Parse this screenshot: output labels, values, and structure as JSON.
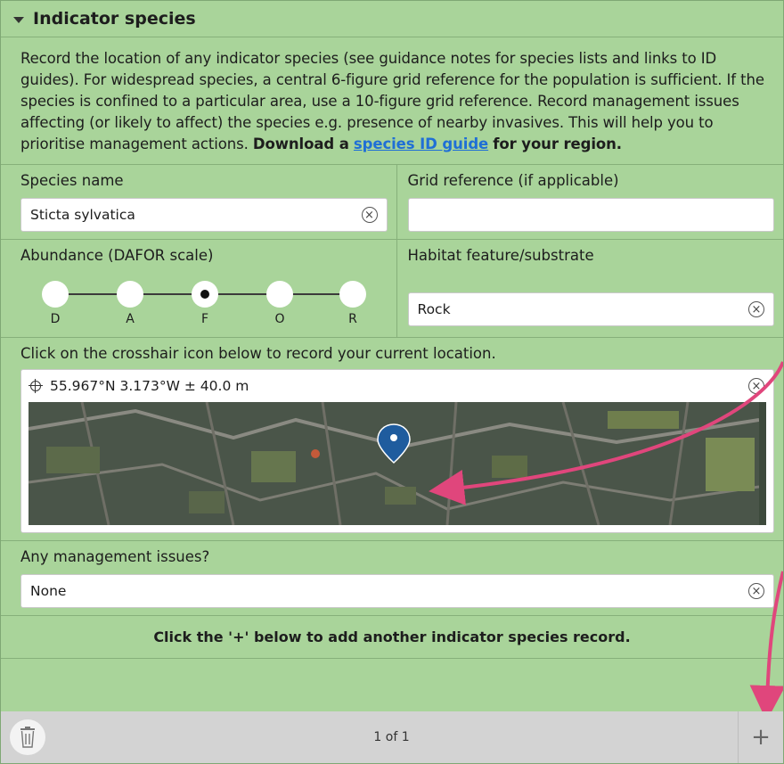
{
  "section": {
    "title": "Indicator species"
  },
  "description": {
    "text": "Record the location of any indicator species (see guidance notes for species lists and links to ID guides). For widespread species, a central 6-figure grid reference for the population is sufficient. If the species is confined to a particular area, use a 10-figure grid reference. Record management issues affecting (or likely to affect) the species e.g. presence of nearby invasives. This will help you to prioritise management actions.",
    "bold_prefix": "Download a",
    "link_text": "species ID guide",
    "bold_suffix": "for your region."
  },
  "species": {
    "label": "Species name",
    "value": "Sticta sylvatica"
  },
  "grid": {
    "label": "Grid reference (if applicable)",
    "value": ""
  },
  "abundance": {
    "label": "Abundance (DAFOR scale)",
    "options": [
      "D",
      "A",
      "F",
      "O",
      "R"
    ],
    "selected": "F"
  },
  "habitat": {
    "label": "Habitat feature/substrate",
    "value": "Rock"
  },
  "location": {
    "label": "Click on the crosshair icon below to record your current location.",
    "coords": "55.967°N 3.173°W ± 40.0 m"
  },
  "management": {
    "label": "Any management issues?",
    "value": "None"
  },
  "note": "Click the '+' below to add another indicator species record.",
  "footer": {
    "pager": "1 of 1"
  },
  "icons": {
    "clear": "clear-icon",
    "crosshair": "crosshair-icon",
    "trash": "trash-icon",
    "plus": "plus-icon",
    "pin": "map-pin-icon"
  },
  "colors": {
    "background": "#a9d49a",
    "link": "#1f6fd6",
    "arrow": "#e0467c"
  }
}
